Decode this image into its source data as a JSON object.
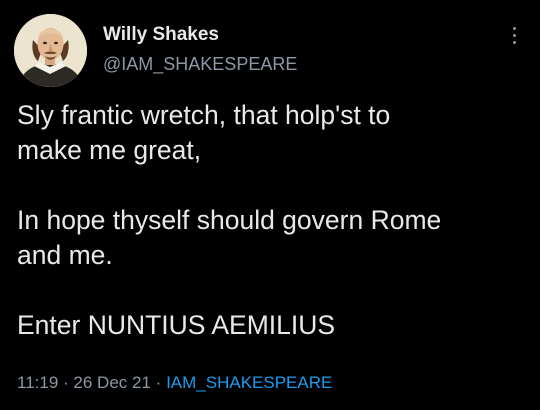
{
  "tweet": {
    "author": {
      "display_name": "Willy Shakes",
      "handle": "@IAM_SHAKESPEARE",
      "avatar_icon": "shakespeare-portrait-avatar"
    },
    "menu_icon": "more-vertical-icon",
    "text": "Sly frantic wretch, that holp'st to\nmake me great,\n\nIn hope thyself should govern Rome\nand me.\n\nEnter NUNTIUS AEMILIUS",
    "time": "11:19",
    "separator": "·",
    "date": "26 Dec 21",
    "source": "IAM_SHAKESPEARE"
  },
  "colors": {
    "background": "#000000",
    "text": "#e7e9ea",
    "secondary_text": "#8b98a5",
    "link": "#1d9bf0"
  }
}
